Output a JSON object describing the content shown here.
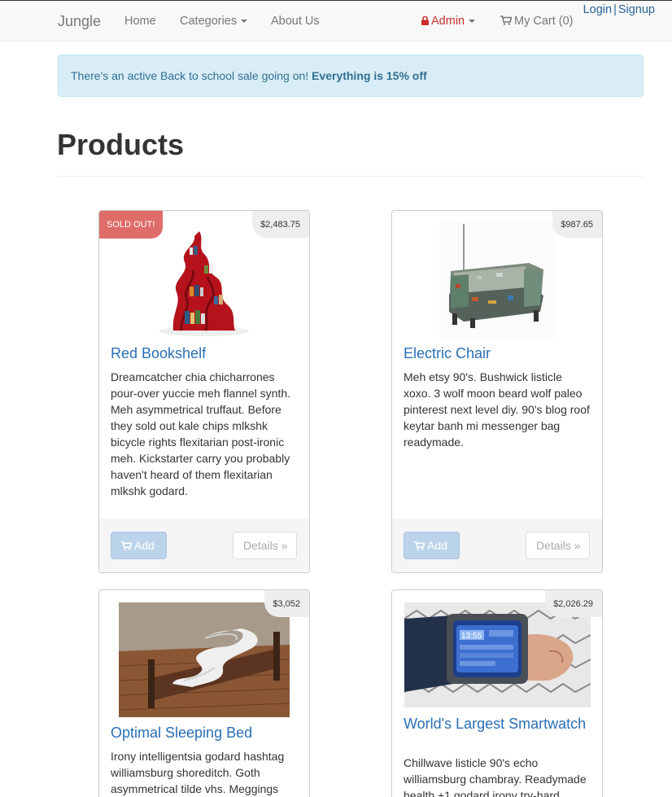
{
  "navbar": {
    "brand": "Jungle",
    "home": "Home",
    "categories": "Categories",
    "about": "About Us",
    "admin": "Admin",
    "cart": "My Cart (0)",
    "login": "Login",
    "separator": "|",
    "signup": "Signup"
  },
  "alert": {
    "text": "There's an active Back to school sale going on!",
    "emphasis": "Everything is 15% off"
  },
  "page": {
    "title": "Products"
  },
  "products": [
    {
      "name": "Red Bookshelf",
      "price": "$2,483.75",
      "badge": "SOLD OUT!",
      "description": "Dreamcatcher chia chicharrones pour-over yuccie meh flannel synth. Meh asymmetrical truffaut. Before they sold out kale chips mlkshk bicycle rights flexitarian post-ironic meh. Kickstarter carry you probably haven't heard of them flexitarian mlkshk godard.",
      "add_label": "Add",
      "details_label": "Details »"
    },
    {
      "name": "Electric Chair",
      "price": "$987.65",
      "description": "Meh etsy 90's. Bushwick listicle xoxo. 3 wolf moon beard wolf paleo pinterest next level diy. 90's blog roof keytar banh mi messenger bag readymade.",
      "add_label": "Add",
      "details_label": "Details »"
    },
    {
      "name": "Optimal Sleeping Bed",
      "price": "$3,052",
      "description": "Irony intelligentsia godard hashtag williamsburg shoreditch. Goth asymmetrical tilde vhs. Meggings"
    },
    {
      "name": "World's Largest Smartwatch",
      "price": "$2,026.29",
      "description": "Chillwave listicle 90's echo williamsburg chambray. Readymade health +1 godard irony try-hard"
    }
  ],
  "watch_screen_text": "13:55",
  "colors": {
    "link": "#2a6fb6",
    "alert_bg": "#d9edf7",
    "soldout": "#d9534f"
  }
}
